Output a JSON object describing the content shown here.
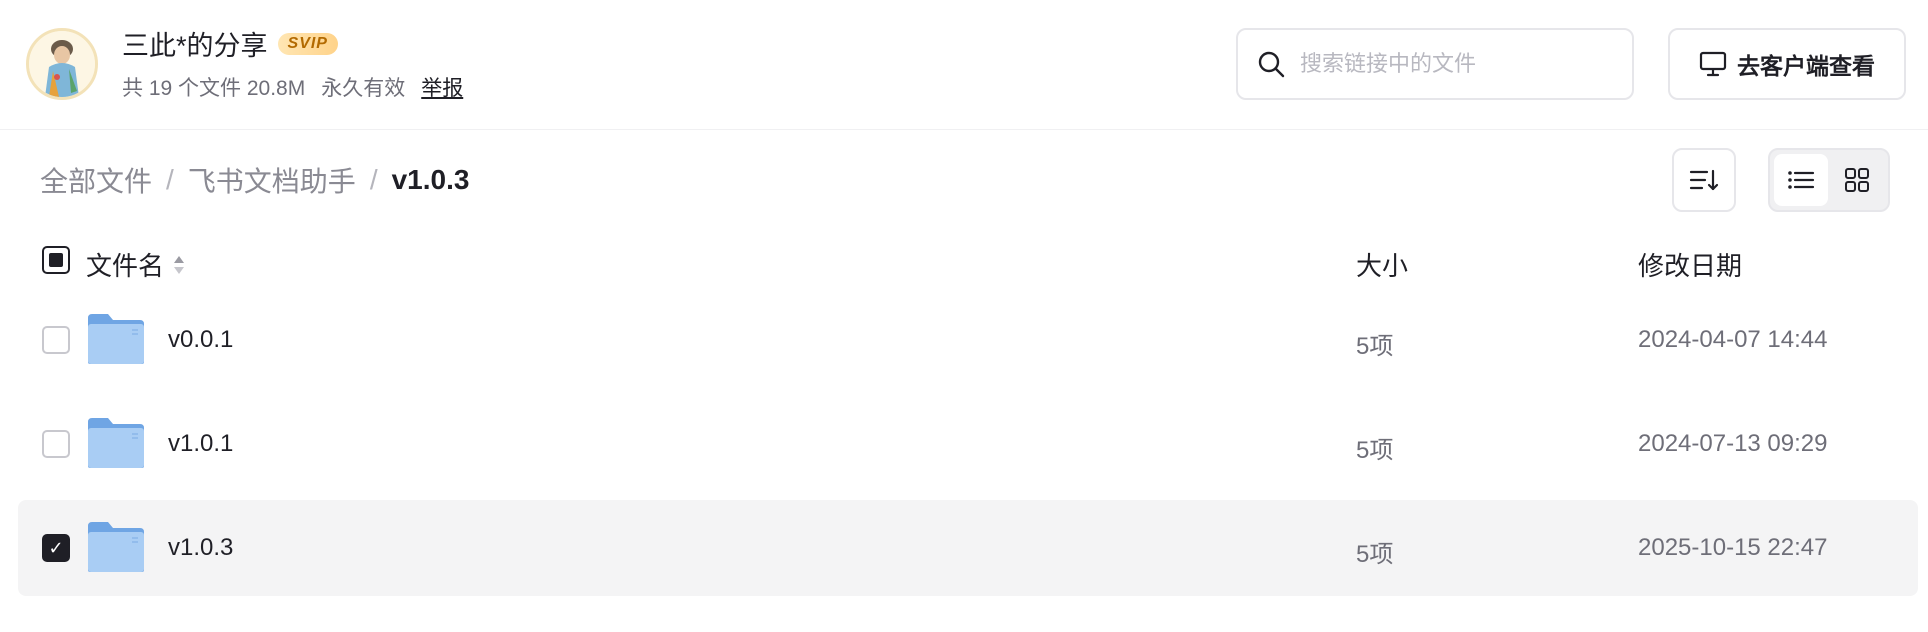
{
  "share": {
    "owner_name": "三此*的分享",
    "badge": "SVIP",
    "file_count_text": "共 19 个文件 20.8M",
    "validity": "永久有效",
    "report_label": "举报"
  },
  "search": {
    "placeholder": "搜索链接中的文件"
  },
  "client_button_label": "去客户端查看",
  "breadcrumb": {
    "items": [
      "全部文件",
      "飞书文档助手",
      "v1.0.3"
    ],
    "separator": "/"
  },
  "table": {
    "columns": {
      "name": "文件名",
      "size": "大小",
      "modified": "修改日期"
    },
    "rows": [
      {
        "name": "v0.0.1",
        "size": "5项",
        "modified": "2024-04-07 14:44",
        "checked": false
      },
      {
        "name": "v1.0.1",
        "size": "5项",
        "modified": "2024-07-13 09:29",
        "checked": false
      },
      {
        "name": "v1.0.3",
        "size": "5项",
        "modified": "2025-10-15 22:47",
        "checked": true
      }
    ]
  },
  "icons": {
    "search": "search-icon",
    "client": "monitor-icon",
    "sort": "sort-icon",
    "list_view": "list-view-icon",
    "grid_view": "grid-view-icon",
    "folder": "folder-icon"
  },
  "colors": {
    "text": "#1f1f26",
    "muted": "#6e6e78",
    "folder": "#8db9ec",
    "selected_row": "#f4f4f5"
  }
}
